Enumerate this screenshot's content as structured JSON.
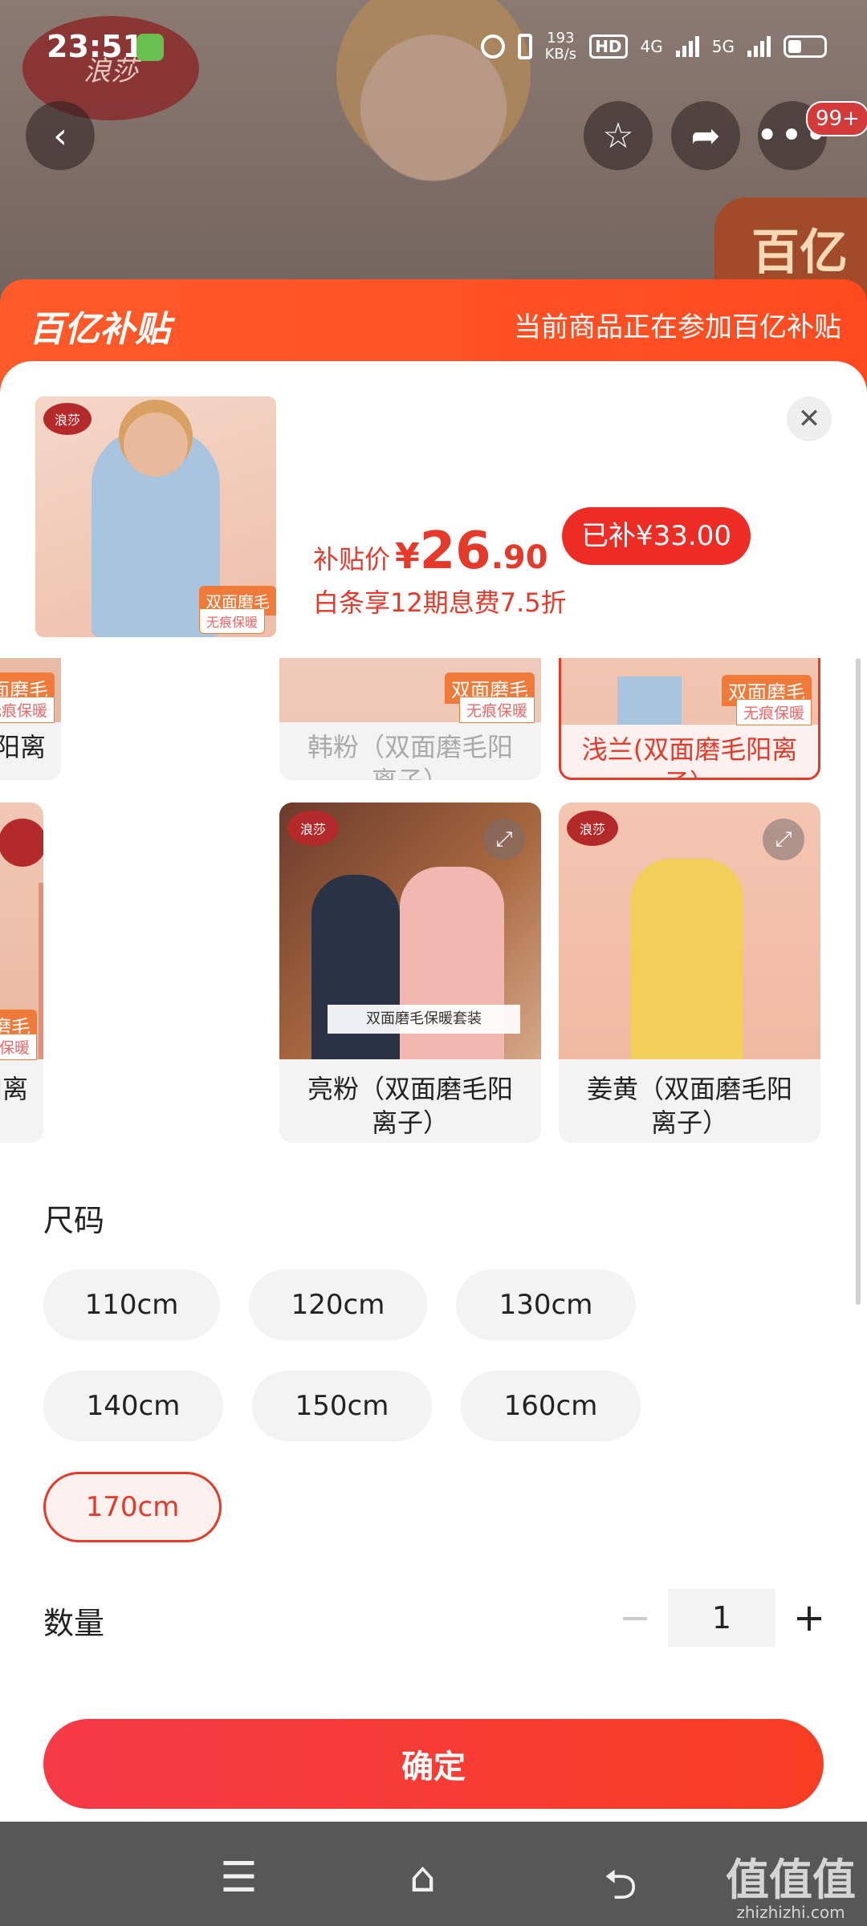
{
  "status_bar": {
    "time": "23:51",
    "net_speed_value": "193",
    "net_speed_unit": "KB/s",
    "hd_label": "HD",
    "network_4g": "4G",
    "network_5g": "5G"
  },
  "hero": {
    "brand_logo_text": "浪莎",
    "badge_text": "百亿",
    "more_badge": "99+"
  },
  "subsidy_banner": {
    "logo_text": "百亿补贴",
    "message": "当前商品正在参加百亿补贴"
  },
  "product": {
    "thumb_tag": "双面磨毛",
    "thumb_tag_sub": "无痕保暖",
    "price_label": "补贴价",
    "price_currency": "¥",
    "price_integer": "26",
    "price_decimal": ".90",
    "subsidy_amount": "已补¥33.00",
    "installment": "白条享12期息费7.5折"
  },
  "colors": [
    {
      "label": "丈青（双面磨毛阳离子）",
      "tag": "双面磨毛",
      "tag_sub": "无痕保暖",
      "state": "normal"
    },
    {
      "label": "韩粉（双面磨毛阳离子）",
      "tag": "双面磨毛",
      "tag_sub": "无痕保暖",
      "state": "disabled"
    },
    {
      "label": "浅兰(双面磨毛阳离子）",
      "tag": "双面磨毛",
      "tag_sub": "无痕保暖",
      "state": "selected"
    },
    {
      "label": "桔粉（双面磨毛阳离子）",
      "tag": "双面磨毛",
      "tag_sub": "无痕保暖",
      "state": "normal"
    },
    {
      "label": "亮粉（双面磨毛阳离子）",
      "strip": "双面磨毛保暖套装",
      "state": "normal"
    },
    {
      "label": "姜黄（双面磨毛阳离子）",
      "state": "normal"
    }
  ],
  "size": {
    "title": "尺码",
    "options": [
      "110cm",
      "120cm",
      "130cm",
      "140cm",
      "150cm",
      "160cm",
      "170cm"
    ],
    "selected": "170cm"
  },
  "quantity": {
    "title": "数量",
    "minus": "−",
    "value": "1",
    "plus": "+"
  },
  "confirm_label": "确定",
  "watermark": {
    "title": "值值值",
    "site": "zhizhizhi.com"
  },
  "colors_theme": {
    "accent": "#e5392a",
    "banner": "#ff5a2a"
  }
}
